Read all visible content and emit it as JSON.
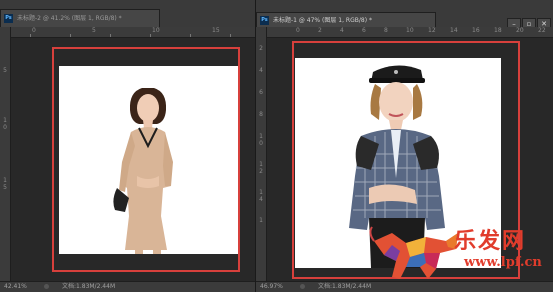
{
  "left_window": {
    "tab_title": "未标题-2 @ 41.2% (图层 1, RGB/8) *",
    "app_badge": "Ps",
    "ruler_h": [
      "0",
      "5",
      "10",
      "15"
    ],
    "ruler_v": [
      "5",
      "1",
      "0",
      "1",
      "5"
    ],
    "status": {
      "zoom": "42.41%",
      "info": "文档:1.83M/2.44M"
    }
  },
  "right_window": {
    "tab_title": "未标题-1 @ 47% (图层 1, RGB/8) *",
    "app_badge": "Ps",
    "window_buttons": {
      "minimize": "–",
      "restore": "▫",
      "close": "✕"
    },
    "ruler_h": [
      "0",
      "2",
      "4",
      "6",
      "8",
      "10",
      "12",
      "14",
      "16",
      "18",
      "20",
      "22"
    ],
    "ruler_v": [
      "2",
      "4",
      "6",
      "8",
      "1",
      "0",
      "1",
      "2",
      "1",
      "4",
      "1"
    ],
    "status": {
      "zoom": "46.97%",
      "info": "文档:1.83M/2.44M"
    }
  },
  "watermark": {
    "title": "乐发网",
    "url": "www.lpf.cn"
  },
  "colors": {
    "selection_box": "#d7403c",
    "watermark": "#e13c2c"
  }
}
